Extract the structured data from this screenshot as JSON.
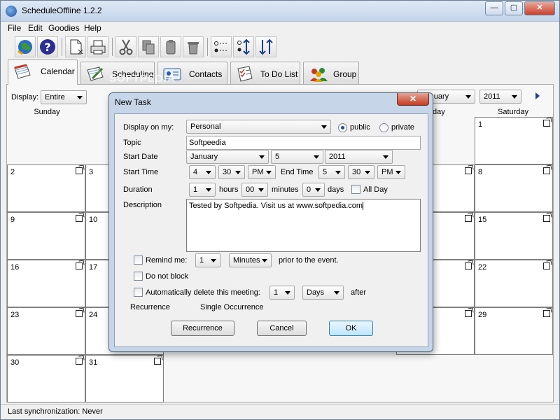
{
  "app": {
    "title": "ScheduleOffline 1.2.2"
  },
  "window_controls": {
    "minimize": "—",
    "maximize": "▢",
    "close": "✕"
  },
  "menu": [
    "File",
    "Edit",
    "Goodies",
    "Help"
  ],
  "toolbar": {
    "icons": [
      "globe-sync-icon",
      "help-icon",
      "new-document-icon",
      "print-icon",
      "cut-icon",
      "copy-icon",
      "paste-icon",
      "delete-icon",
      "list-options-icon",
      "sort-updown-icon",
      "sort-icon"
    ]
  },
  "tabs": [
    {
      "label": "Calendar",
      "icon": "calendar-icon",
      "active": true
    },
    {
      "label": "Scheduling",
      "icon": "scheduling-icon",
      "active": false
    },
    {
      "label": "Contacts",
      "icon": "contacts-icon",
      "active": false
    },
    {
      "label": "To Do List",
      "icon": "todo-icon",
      "active": false
    },
    {
      "label": "Group",
      "icon": "group-icon",
      "active": false
    }
  ],
  "calendar": {
    "display_label": "Display:",
    "display_value": "Entire",
    "month_value": "January",
    "year_value": "2011",
    "day_names": [
      "Sunday",
      "Saturday"
    ],
    "friday_partial": "day",
    "days": [
      "1",
      "2",
      "3",
      "8",
      "9",
      "10",
      "15",
      "16",
      "17",
      "22",
      "23",
      "24",
      "29",
      "30",
      "31"
    ]
  },
  "watermark": "SOFTPEDIA",
  "status": {
    "text": "Last synchronization: Never"
  },
  "dialog": {
    "title": "New Task",
    "close": "✕",
    "display_on_label": "Display on my:",
    "display_on_value": "Personal",
    "public_label": "public",
    "private_label": "private",
    "topic_label": "Topic",
    "topic_value": "Softpeedia",
    "start_date_label": "Start Date",
    "start_month": "January",
    "start_day": "5",
    "start_year": "2011",
    "start_time_label": "Start Time",
    "start_hour": "4",
    "start_min": "30",
    "start_ampm": "PM",
    "end_time_label": "End Time",
    "end_hour": "5",
    "end_min": "30",
    "end_ampm": "PM",
    "duration_label": "Duration",
    "dur_hours": "1",
    "hours_label": "hours",
    "dur_minutes": "00",
    "minutes_label": "minutes",
    "dur_days": "0",
    "days_label": "days",
    "all_day_label": "All Day",
    "description_label": "Description",
    "description_value": "Tested by Softpedia. Visit us at www.softpedia.com",
    "remind_label": "Remind me:",
    "remind_value": "1",
    "remind_unit": "Minutes",
    "prior_label": "prior to the event.",
    "do_not_block_label": "Do not block",
    "auto_delete_label": "Automatically delete this meeting:",
    "auto_delete_value": "1",
    "auto_delete_unit": "Days",
    "after_label": "after",
    "recurrence_label": "Recurrence",
    "recurrence_value": "Single Occurrence",
    "btn_recurrence": "Recurrence",
    "btn_cancel": "Cancel",
    "btn_ok": "OK"
  }
}
